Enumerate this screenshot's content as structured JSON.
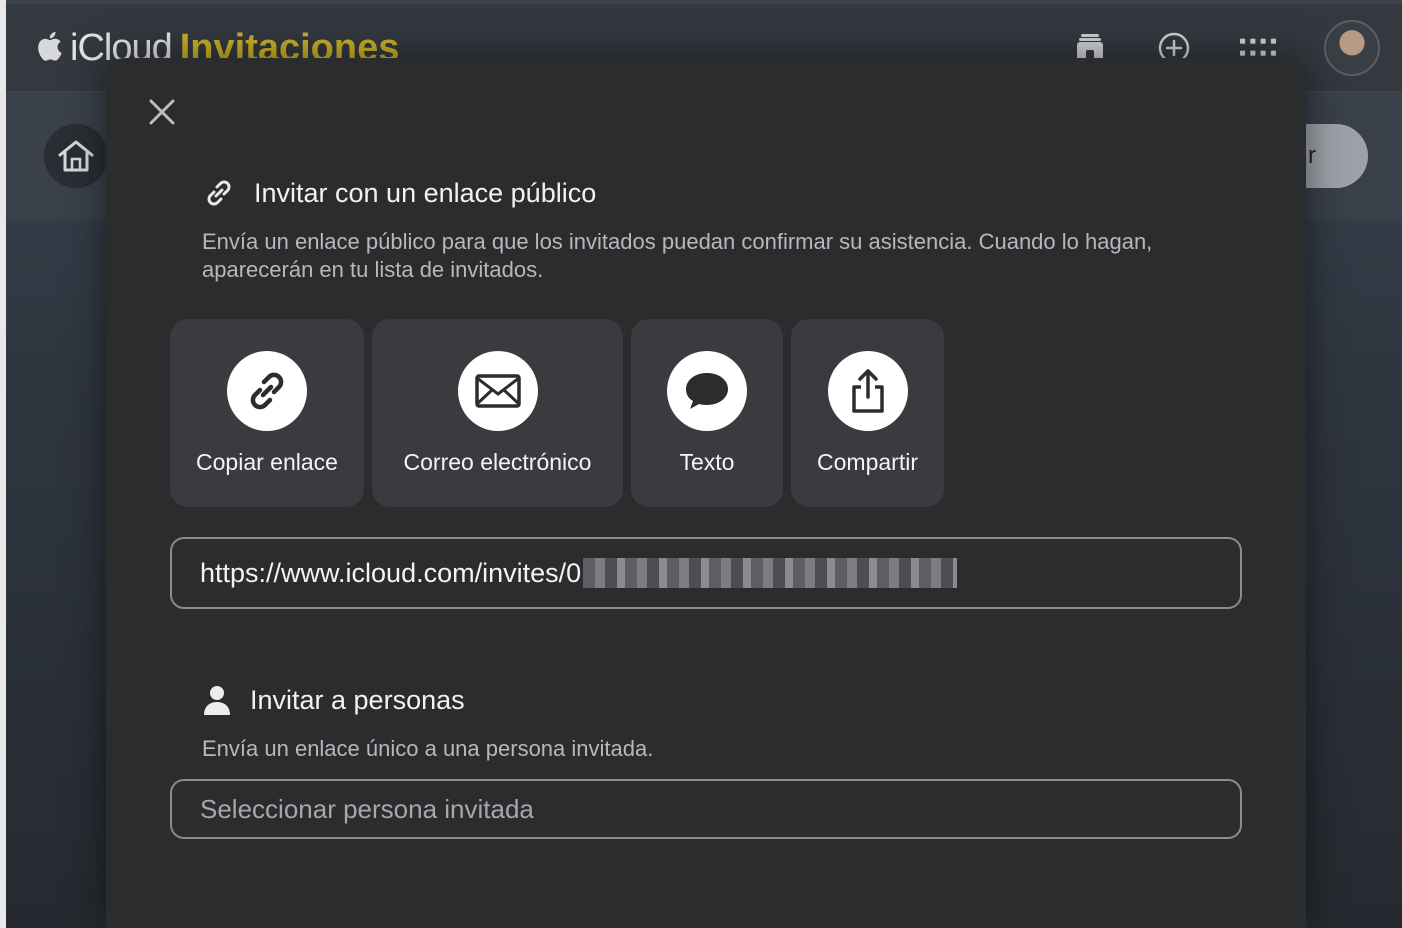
{
  "app": {
    "brand_icloud": "iCloud",
    "brand_app": "Invitaciones",
    "accent_color": "#c9b127"
  },
  "header": {
    "icons": [
      "invites-inbox-icon",
      "add-circle-icon",
      "app-grid-icon"
    ],
    "subbar_button_label": "r"
  },
  "modal": {
    "public_link": {
      "title": "Invitar con un enlace público",
      "description": "Envía un enlace público para que los invitados puedan confirmar su asistencia. Cuando lo hagan, aparecerán en tu lista de invitados.",
      "actions": [
        {
          "label": "Copiar enlace",
          "icon": "link-icon"
        },
        {
          "label": "Correo electrónico",
          "icon": "mail-icon"
        },
        {
          "label": "Texto",
          "icon": "message-bubble-icon"
        },
        {
          "label": "Compartir",
          "icon": "share-icon"
        }
      ],
      "url_value": "https://www.icloud.com/invites/0"
    },
    "invite_people": {
      "title": "Invitar a personas",
      "description": "Envía un enlace único a una persona invitada.",
      "select_placeholder": "Seleccionar persona invitada"
    }
  }
}
